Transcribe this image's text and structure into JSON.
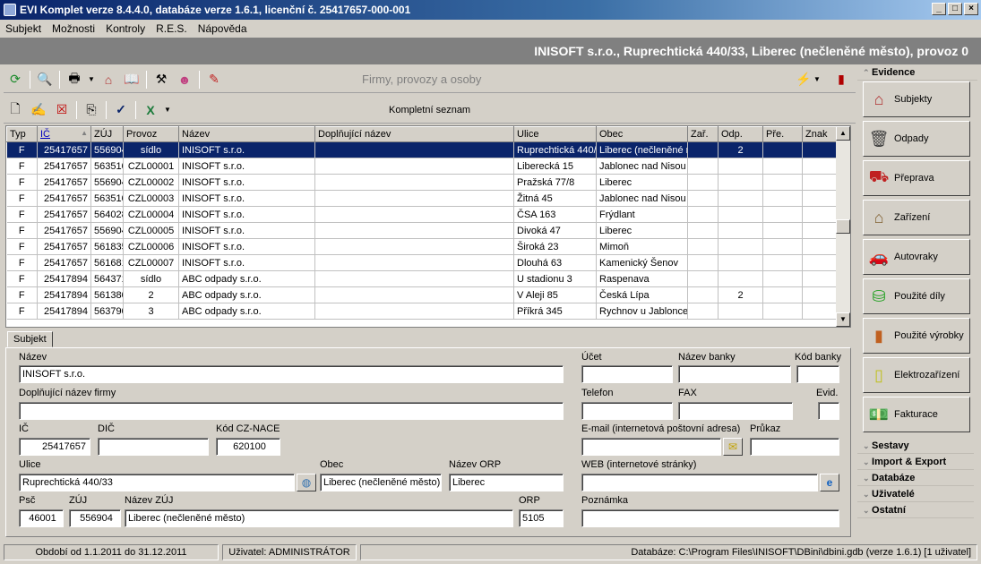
{
  "window": {
    "title": "EVI Komplet verze 8.4.4.0, databáze verze 1.6.1, licenční č. 25417657-000-001"
  },
  "menu": [
    "Subjekt",
    "Možnosti",
    "Kontroly",
    "R.E.S.",
    "Nápověda"
  ],
  "banner": "INISOFT s.r.o., Ruprechtická 440/33, Liberec (nečleněné město), provoz 0",
  "toolbar1": {
    "title": "Firmy, provozy a osoby"
  },
  "toolbar2": {
    "title": "Kompletní seznam"
  },
  "grid": {
    "columns": [
      "Typ",
      "IČ",
      "ZÚJ",
      "Provoz",
      "Název",
      "Doplňující název",
      "Ulice",
      "Obec",
      "Zař.",
      "Odp.",
      "Pře.",
      "Znak"
    ],
    "rows": [
      [
        "F",
        "25417657",
        "556904",
        "sídlo",
        "INISOFT s.r.o.",
        "",
        "Ruprechtická 440/",
        "Liberec (nečleněné m",
        "",
        "2",
        "",
        ""
      ],
      [
        "F",
        "25417657",
        "563510",
        "CZL00001",
        "INISOFT s.r.o.",
        "",
        "Liberecká 15",
        "Jablonec nad Nisou",
        "",
        "",
        "",
        ""
      ],
      [
        "F",
        "25417657",
        "556904",
        "CZL00002",
        "INISOFT s.r.o.",
        "",
        "Pražská 77/8",
        "Liberec",
        "",
        "",
        "",
        ""
      ],
      [
        "F",
        "25417657",
        "563510",
        "CZL00003",
        "INISOFT s.r.o.",
        "",
        "Žitná 45",
        "Jablonec nad Nisou",
        "",
        "",
        "",
        ""
      ],
      [
        "F",
        "25417657",
        "564028",
        "CZL00004",
        "INISOFT s.r.o.",
        "",
        "ČSA 163",
        "Frýdlant",
        "",
        "",
        "",
        ""
      ],
      [
        "F",
        "25417657",
        "556904",
        "CZL00005",
        "INISOFT s.r.o.",
        "",
        "Divoká 47",
        "Liberec",
        "",
        "",
        "",
        ""
      ],
      [
        "F",
        "25417657",
        "561835",
        "CZL00006",
        "INISOFT s.r.o.",
        "",
        "Široká 23",
        "Mimoň",
        "",
        "",
        "",
        ""
      ],
      [
        "F",
        "25417657",
        "561681",
        "CZL00007",
        "INISOFT s.r.o.",
        "",
        "Dlouhá 63",
        "Kamenický Šenov",
        "",
        "",
        "",
        ""
      ],
      [
        "F",
        "25417894",
        "564371",
        "sídlo",
        "ABC odpady s.r.o.",
        "",
        "U stadionu 3",
        "Raspenava",
        "",
        "",
        "",
        ""
      ],
      [
        "F",
        "25417894",
        "561380",
        "2",
        "ABC odpady s.r.o.",
        "",
        "V Aleji 85",
        "Česká Lípa",
        "",
        "2",
        "",
        ""
      ],
      [
        "F",
        "25417894",
        "563790",
        "3",
        "ABC odpady s.r.o.",
        "",
        "Příkrá 345",
        "Rychnov u Jablonce",
        "",
        "",
        "",
        ""
      ]
    ]
  },
  "tab": "Subjekt",
  "form": {
    "labels": {
      "nazev": "Název",
      "doplnujici": "Doplňující název firmy",
      "ic": "IČ",
      "dic": "DIČ",
      "nace": "Kód CZ-NACE",
      "ulice": "Ulice",
      "obec": "Obec",
      "orp_nazev": "Název ORP",
      "psc": "Psč",
      "zuj": "ZÚJ",
      "zuj_nazev": "Název ZÚJ",
      "orp": "ORP",
      "ucet": "Účet",
      "banka": "Název banky",
      "kod_banky": "Kód banky",
      "telefon": "Telefon",
      "fax": "FAX",
      "evid": "Evid.",
      "email": "E-mail (internetová poštovní adresa)",
      "prukaz": "Průkaz",
      "web": "WEB (internetové stránky)",
      "poznamka": "Poznámka"
    },
    "values": {
      "nazev": "INISOFT s.r.o.",
      "doplnujici": "",
      "ic": "25417657",
      "dic": "",
      "nace": "620100",
      "ulice": "Ruprechtická 440/33",
      "obec": "Liberec (nečleněné město)",
      "orp_nazev": "Liberec",
      "psc": "46001",
      "zuj": "556904",
      "zuj_nazev": "Liberec (nečleněné město)",
      "orp": "5105",
      "ucet": "",
      "banka": "",
      "kod_banky": "",
      "telefon": "",
      "fax": "",
      "evid": "",
      "email": "",
      "prukaz": "",
      "web": "",
      "poznamka": ""
    }
  },
  "sidebar": {
    "evidence": "Evidence",
    "items": [
      "Subjekty",
      "Odpady",
      "Přeprava",
      "Zařízení",
      "Autovraky",
      "Použité díly",
      "Použité výrobky",
      "Elektrozařízení",
      "Fakturace"
    ],
    "groups": [
      "Sestavy",
      "Import & Export",
      "Databáze",
      "Uživatelé",
      "Ostatní"
    ]
  },
  "status": {
    "period": "Období od 1.1.2011 do 31.12.2011",
    "user": "Uživatel: ADMINISTRÁTOR",
    "db": "Databáze: C:\\Program Files\\INISOFT\\DBini\\dbini.gdb  (verze 1.6.1) [1 uživatel]"
  },
  "icons": {
    "accent": "#0a246a"
  }
}
